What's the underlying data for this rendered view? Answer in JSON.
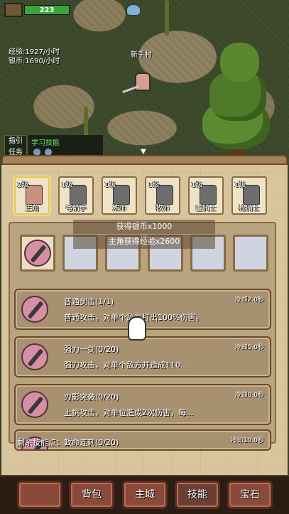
{
  "player": {
    "hp": "223",
    "hp_fraction": 1.0
  },
  "map": {
    "name": "新手村",
    "exp_rate": "经验:1927/小时",
    "silver_rate": "银币:1690/小时"
  },
  "guide": {
    "line1": "指引",
    "line2": "任务"
  },
  "quest": {
    "title": "学习技能"
  },
  "classes": [
    {
      "level": "2级",
      "name": "主角",
      "active": true
    },
    {
      "level": "1级",
      "name": "弓箭手",
      "active": false
    },
    {
      "level": "1级",
      "name": "法师",
      "active": false
    },
    {
      "level": "1级",
      "name": "牧师",
      "active": false
    },
    {
      "level": "1级",
      "name": "重骑士",
      "active": false
    },
    {
      "level": "1级",
      "name": "枪骑士",
      "active": false
    }
  ],
  "toasts": [
    "获得银币x1000",
    "主角获得经验x2600"
  ],
  "equipped_skill_icon": "sword-skill-icon",
  "skills": [
    {
      "name": "普通剑击(1/1)",
      "desc": "普通攻击，对单个敌方打出100%伤害。",
      "cooldown": "冷却2.0秒",
      "icon": "sword-icon"
    },
    {
      "name": "强力一剑(0/20)",
      "desc": "强力攻击，对单个敌方并造成110...",
      "cooldown": "冷却5.0秒",
      "icon": "blade-icon"
    },
    {
      "name": "刃影突袭(0/20)",
      "desc": "上挑攻击，对单位造成2次伤害，每...",
      "cooldown": "冷却8.0秒",
      "icon": "dagger-icon"
    },
    {
      "name": "致命连刺(0/20)",
      "desc": "",
      "cooldown": "冷却10.0秒",
      "icon": "spear-icon"
    }
  ],
  "remaining_points": "剩余技能点：1",
  "tabs": [
    "",
    "背包",
    "主城",
    "技能",
    "宝石"
  ],
  "active_tab": "技能"
}
